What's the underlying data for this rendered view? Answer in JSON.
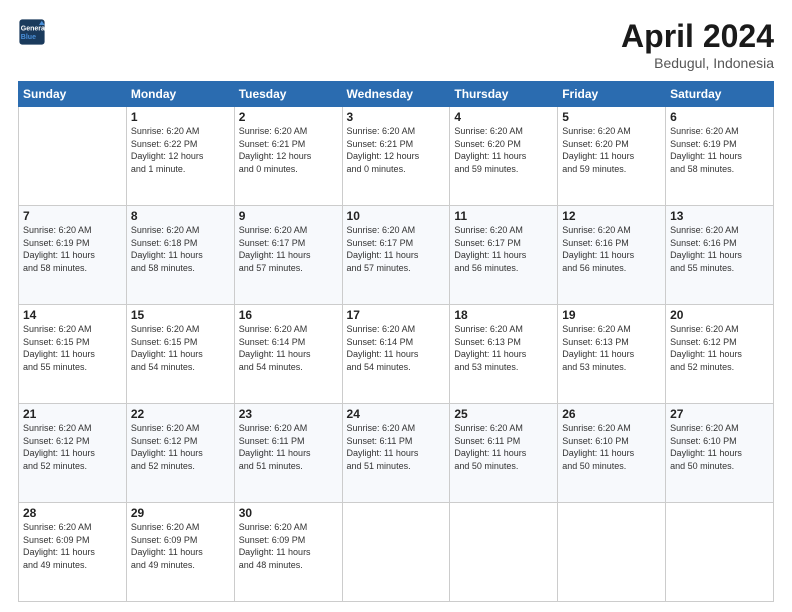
{
  "header": {
    "logo_line1": "General",
    "logo_line2": "Blue",
    "month_title": "April 2024",
    "location": "Bedugul, Indonesia"
  },
  "days_of_week": [
    "Sunday",
    "Monday",
    "Tuesday",
    "Wednesday",
    "Thursday",
    "Friday",
    "Saturday"
  ],
  "weeks": [
    [
      {
        "day": "",
        "data": ""
      },
      {
        "day": "1",
        "data": "Sunrise: 6:20 AM\nSunset: 6:22 PM\nDaylight: 12 hours\nand 1 minute."
      },
      {
        "day": "2",
        "data": "Sunrise: 6:20 AM\nSunset: 6:21 PM\nDaylight: 12 hours\nand 0 minutes."
      },
      {
        "day": "3",
        "data": "Sunrise: 6:20 AM\nSunset: 6:21 PM\nDaylight: 12 hours\nand 0 minutes."
      },
      {
        "day": "4",
        "data": "Sunrise: 6:20 AM\nSunset: 6:20 PM\nDaylight: 11 hours\nand 59 minutes."
      },
      {
        "day": "5",
        "data": "Sunrise: 6:20 AM\nSunset: 6:20 PM\nDaylight: 11 hours\nand 59 minutes."
      },
      {
        "day": "6",
        "data": "Sunrise: 6:20 AM\nSunset: 6:19 PM\nDaylight: 11 hours\nand 58 minutes."
      }
    ],
    [
      {
        "day": "7",
        "data": "Sunrise: 6:20 AM\nSunset: 6:19 PM\nDaylight: 11 hours\nand 58 minutes."
      },
      {
        "day": "8",
        "data": "Sunrise: 6:20 AM\nSunset: 6:18 PM\nDaylight: 11 hours\nand 58 minutes."
      },
      {
        "day": "9",
        "data": "Sunrise: 6:20 AM\nSunset: 6:17 PM\nDaylight: 11 hours\nand 57 minutes."
      },
      {
        "day": "10",
        "data": "Sunrise: 6:20 AM\nSunset: 6:17 PM\nDaylight: 11 hours\nand 57 minutes."
      },
      {
        "day": "11",
        "data": "Sunrise: 6:20 AM\nSunset: 6:17 PM\nDaylight: 11 hours\nand 56 minutes."
      },
      {
        "day": "12",
        "data": "Sunrise: 6:20 AM\nSunset: 6:16 PM\nDaylight: 11 hours\nand 56 minutes."
      },
      {
        "day": "13",
        "data": "Sunrise: 6:20 AM\nSunset: 6:16 PM\nDaylight: 11 hours\nand 55 minutes."
      }
    ],
    [
      {
        "day": "14",
        "data": "Sunrise: 6:20 AM\nSunset: 6:15 PM\nDaylight: 11 hours\nand 55 minutes."
      },
      {
        "day": "15",
        "data": "Sunrise: 6:20 AM\nSunset: 6:15 PM\nDaylight: 11 hours\nand 54 minutes."
      },
      {
        "day": "16",
        "data": "Sunrise: 6:20 AM\nSunset: 6:14 PM\nDaylight: 11 hours\nand 54 minutes."
      },
      {
        "day": "17",
        "data": "Sunrise: 6:20 AM\nSunset: 6:14 PM\nDaylight: 11 hours\nand 54 minutes."
      },
      {
        "day": "18",
        "data": "Sunrise: 6:20 AM\nSunset: 6:13 PM\nDaylight: 11 hours\nand 53 minutes."
      },
      {
        "day": "19",
        "data": "Sunrise: 6:20 AM\nSunset: 6:13 PM\nDaylight: 11 hours\nand 53 minutes."
      },
      {
        "day": "20",
        "data": "Sunrise: 6:20 AM\nSunset: 6:12 PM\nDaylight: 11 hours\nand 52 minutes."
      }
    ],
    [
      {
        "day": "21",
        "data": "Sunrise: 6:20 AM\nSunset: 6:12 PM\nDaylight: 11 hours\nand 52 minutes."
      },
      {
        "day": "22",
        "data": "Sunrise: 6:20 AM\nSunset: 6:12 PM\nDaylight: 11 hours\nand 52 minutes."
      },
      {
        "day": "23",
        "data": "Sunrise: 6:20 AM\nSunset: 6:11 PM\nDaylight: 11 hours\nand 51 minutes."
      },
      {
        "day": "24",
        "data": "Sunrise: 6:20 AM\nSunset: 6:11 PM\nDaylight: 11 hours\nand 51 minutes."
      },
      {
        "day": "25",
        "data": "Sunrise: 6:20 AM\nSunset: 6:11 PM\nDaylight: 11 hours\nand 50 minutes."
      },
      {
        "day": "26",
        "data": "Sunrise: 6:20 AM\nSunset: 6:10 PM\nDaylight: 11 hours\nand 50 minutes."
      },
      {
        "day": "27",
        "data": "Sunrise: 6:20 AM\nSunset: 6:10 PM\nDaylight: 11 hours\nand 50 minutes."
      }
    ],
    [
      {
        "day": "28",
        "data": "Sunrise: 6:20 AM\nSunset: 6:09 PM\nDaylight: 11 hours\nand 49 minutes."
      },
      {
        "day": "29",
        "data": "Sunrise: 6:20 AM\nSunset: 6:09 PM\nDaylight: 11 hours\nand 49 minutes."
      },
      {
        "day": "30",
        "data": "Sunrise: 6:20 AM\nSunset: 6:09 PM\nDaylight: 11 hours\nand 48 minutes."
      },
      {
        "day": "",
        "data": ""
      },
      {
        "day": "",
        "data": ""
      },
      {
        "day": "",
        "data": ""
      },
      {
        "day": "",
        "data": ""
      }
    ]
  ]
}
